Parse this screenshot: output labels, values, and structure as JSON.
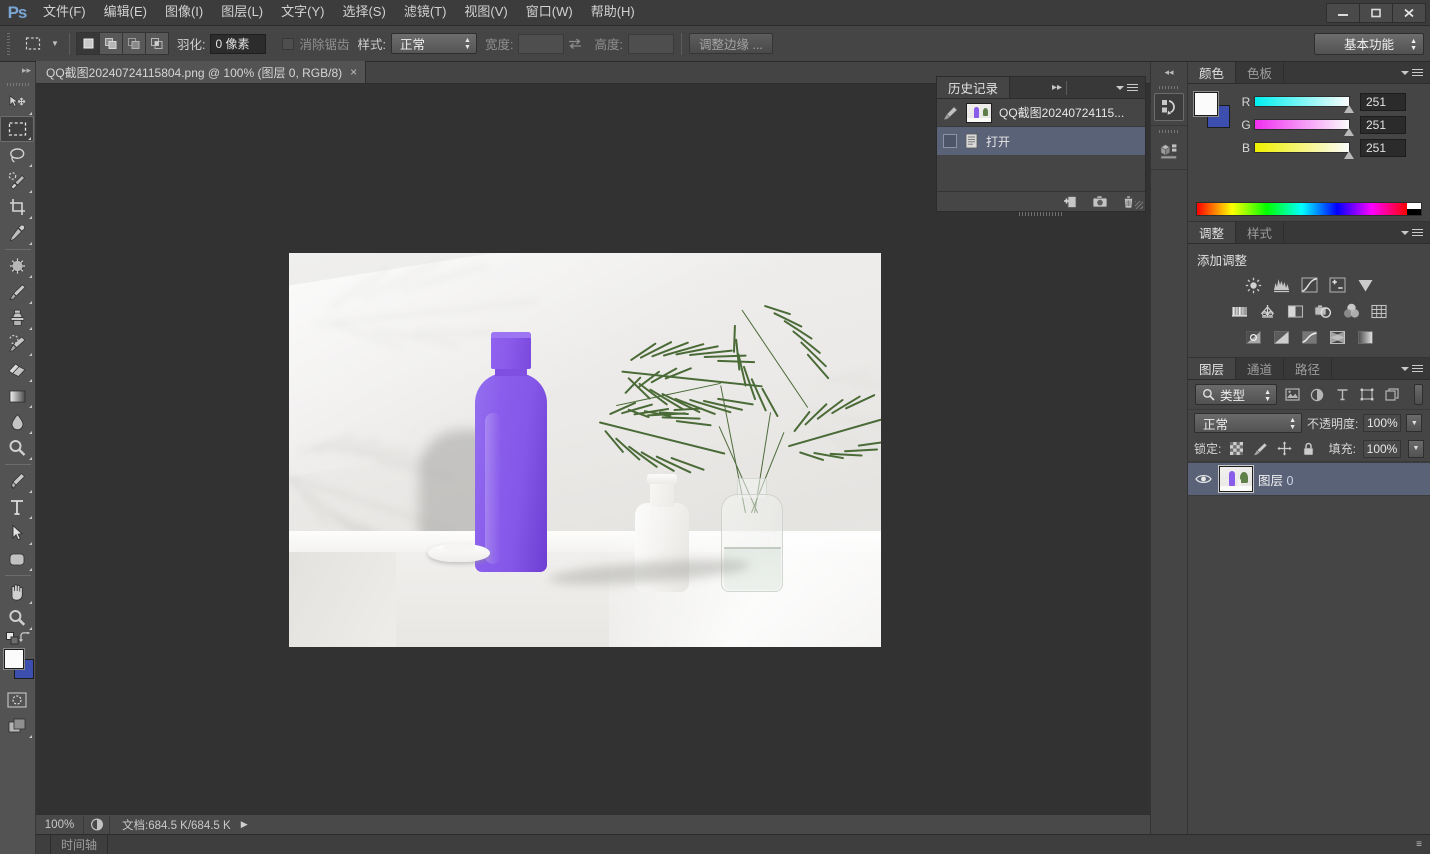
{
  "app": {
    "logo_text": "Ps",
    "accent_color": "#7aa6d6",
    "chrome_bg": "#535353"
  },
  "menubar": {
    "items": [
      {
        "label": "文件(F)",
        "name": "menu-file"
      },
      {
        "label": "编辑(E)",
        "name": "menu-edit"
      },
      {
        "label": "图像(I)",
        "name": "menu-image"
      },
      {
        "label": "图层(L)",
        "name": "menu-layer"
      },
      {
        "label": "文字(Y)",
        "name": "menu-type"
      },
      {
        "label": "选择(S)",
        "name": "menu-select"
      },
      {
        "label": "滤镜(T)",
        "name": "menu-filter"
      },
      {
        "label": "视图(V)",
        "name": "menu-view"
      },
      {
        "label": "窗口(W)",
        "name": "menu-window"
      },
      {
        "label": "帮助(H)",
        "name": "menu-help"
      }
    ]
  },
  "window_controls": {
    "minimize": "minimize-icon",
    "maximize": "maximize-icon",
    "close": "close-icon"
  },
  "options_bar": {
    "tool_icon": "rectangular-marquee-icon",
    "selection_modes": [
      "new-selection",
      "add-to-selection",
      "subtract-from-selection",
      "intersect-with-selection"
    ],
    "active_selection_mode": 0,
    "feather_label": "羽化:",
    "feather_value": "0 像素",
    "antialias_label": "消除锯齿",
    "antialias_checked": false,
    "style_label": "样式:",
    "style_value": "正常",
    "width_label": "宽度:",
    "width_value": "",
    "swap_icon": "swap-dimensions-icon",
    "height_label": "高度:",
    "height_value": "",
    "refine_edge_label": "调整边缘 ...",
    "workspace_value": "基本功能"
  },
  "toolbar": {
    "collapse_icon": "collapse-panel-icon",
    "tools": [
      {
        "name": "move-tool",
        "icon": "move-icon",
        "active": false,
        "has_submenu": true
      },
      {
        "name": "rectangular-marquee-tool",
        "icon": "marquee-icon",
        "active": true,
        "has_submenu": true
      },
      {
        "name": "lasso-tool",
        "icon": "lasso-icon",
        "active": false,
        "has_submenu": true
      },
      {
        "name": "quick-selection-tool",
        "icon": "quick-selection-icon",
        "active": false,
        "has_submenu": true
      },
      {
        "name": "crop-tool",
        "icon": "crop-icon",
        "active": false,
        "has_submenu": true
      },
      {
        "name": "eyedropper-tool",
        "icon": "eyedropper-icon",
        "active": false,
        "has_submenu": true
      },
      {
        "name": "spot-healing-tool",
        "icon": "healing-brush-icon",
        "active": false,
        "has_submenu": true
      },
      {
        "name": "brush-tool",
        "icon": "brush-icon",
        "active": false,
        "has_submenu": true
      },
      {
        "name": "clone-stamp-tool",
        "icon": "clone-stamp-icon",
        "active": false,
        "has_submenu": true
      },
      {
        "name": "history-brush-tool",
        "icon": "history-brush-icon",
        "active": false,
        "has_submenu": true
      },
      {
        "name": "eraser-tool",
        "icon": "eraser-icon",
        "active": false,
        "has_submenu": true
      },
      {
        "name": "gradient-tool",
        "icon": "gradient-icon",
        "active": false,
        "has_submenu": true
      },
      {
        "name": "blur-tool",
        "icon": "blur-drop-icon",
        "active": false,
        "has_submenu": true
      },
      {
        "name": "dodge-tool",
        "icon": "dodge-icon",
        "active": false,
        "has_submenu": true
      },
      {
        "name": "pen-tool",
        "icon": "pen-icon",
        "active": false,
        "has_submenu": true
      },
      {
        "name": "type-tool",
        "icon": "type-t-icon",
        "active": false,
        "has_submenu": true
      },
      {
        "name": "path-selection-tool",
        "icon": "path-arrow-icon",
        "active": false,
        "has_submenu": true
      },
      {
        "name": "shape-tool",
        "icon": "rounded-rect-icon",
        "active": false,
        "has_submenu": true
      },
      {
        "name": "hand-tool",
        "icon": "hand-icon",
        "active": false,
        "has_submenu": true
      },
      {
        "name": "zoom-tool",
        "icon": "magnifier-icon",
        "active": false,
        "has_submenu": true
      }
    ],
    "default_colors_icon": "default-colors-icon",
    "swap_colors_icon": "swap-colors-icon",
    "foreground_color": "#fbfbfb",
    "background_color": "#3c4fae",
    "quick_mask_icon": "quick-mask-icon",
    "screen_mode_icon": "screen-mode-icon"
  },
  "document": {
    "tab_title": "QQ截图20240724115804.png @ 100% (图层 0, RGB/8)",
    "close_icon": "close-tab-icon"
  },
  "status_bar": {
    "zoom": "100%",
    "zoom_icon": "document-profile-icon",
    "doc_label": "文档:684.5 K/684.5 K",
    "expand_icon": "play-arrow-icon"
  },
  "timeline": {
    "tab_label": "时间轴",
    "menu_icon": "panel-menu-icon"
  },
  "mini_dock": {
    "collapse_icon": "expand-panels-icon",
    "buttons": [
      {
        "name": "history-dock-icon",
        "icon": "history-icon",
        "active": true
      },
      {
        "name": "mini-bridge-dock-icon",
        "icon": "mini-bridge-icon",
        "active": false
      }
    ]
  },
  "history_panel": {
    "tabs": [
      {
        "label": "历史记录",
        "active": true
      }
    ],
    "collapse_icon": "collapse-double-arrow-icon",
    "menu_icon": "panel-menu-icon",
    "snapshot": {
      "label": "QQ截图20240724115...",
      "brush_icon": "history-brush-source-icon"
    },
    "states": [
      {
        "label": "打开",
        "icon": "open-document-icon",
        "selected": true
      }
    ],
    "footer_buttons": [
      {
        "name": "new-document-from-state-button",
        "icon": "new-doc-icon"
      },
      {
        "name": "new-snapshot-button",
        "icon": "camera-icon"
      },
      {
        "name": "delete-state-button",
        "icon": "trash-icon"
      }
    ]
  },
  "color_panel": {
    "tabs": [
      {
        "label": "颜色",
        "active": true
      },
      {
        "label": "色板",
        "active": false
      }
    ],
    "menu_icon": "panel-menu-icon",
    "foreground_color": "#fbfbfb",
    "background_color": "#3c4fae",
    "channels": [
      {
        "label": "R",
        "value": "251"
      },
      {
        "label": "G",
        "value": "251"
      },
      {
        "label": "B",
        "value": "251"
      }
    ]
  },
  "adjustments_panel": {
    "tabs": [
      {
        "label": "调整",
        "active": true
      },
      {
        "label": "样式",
        "active": false
      }
    ],
    "menu_icon": "panel-menu-icon",
    "heading": "添加调整",
    "rows": [
      [
        {
          "name": "brightness-contrast-adjustment",
          "icon": "sun-icon"
        },
        {
          "name": "levels-adjustment",
          "icon": "levels-icon"
        },
        {
          "name": "curves-adjustment",
          "icon": "curves-icon"
        },
        {
          "name": "exposure-adjustment",
          "icon": "exposure-icon"
        },
        {
          "name": "vibrance-adjustment",
          "icon": "vibrance-triangle-icon"
        }
      ],
      [
        {
          "name": "hue-saturation-adjustment",
          "icon": "hue-saturation-icon"
        },
        {
          "name": "color-balance-adjustment",
          "icon": "balance-scale-icon"
        },
        {
          "name": "black-white-adjustment",
          "icon": "black-white-icon"
        },
        {
          "name": "photo-filter-adjustment",
          "icon": "camera-filter-icon"
        },
        {
          "name": "channel-mixer-adjustment",
          "icon": "venn-circles-icon"
        },
        {
          "name": "color-lookup-adjustment",
          "icon": "grid-icon"
        }
      ],
      [
        {
          "name": "invert-adjustment",
          "icon": "invert-icon"
        },
        {
          "name": "posterize-adjustment",
          "icon": "posterize-icon"
        },
        {
          "name": "threshold-adjustment",
          "icon": "threshold-icon"
        },
        {
          "name": "gradient-map-adjustment",
          "icon": "gradient-map-icon"
        },
        {
          "name": "selective-color-adjustment",
          "icon": "selective-color-icon"
        }
      ]
    ]
  },
  "layers_panel": {
    "tabs": [
      {
        "label": "图层",
        "active": true
      },
      {
        "label": "通道",
        "active": false
      },
      {
        "label": "路径",
        "active": false
      }
    ],
    "menu_icon": "panel-menu-icon",
    "filter": {
      "search_icon": "search-icon",
      "value": "类型",
      "kind_icons": [
        {
          "name": "filter-pixel-layers-icon",
          "icon": "image-icon"
        },
        {
          "name": "filter-adjustment-layers-icon",
          "icon": "half-circle-icon"
        },
        {
          "name": "filter-type-layers-icon",
          "icon": "type-t-icon"
        },
        {
          "name": "filter-shape-layers-icon",
          "icon": "shape-icon"
        },
        {
          "name": "filter-smart-objects-icon",
          "icon": "smart-object-icon"
        }
      ],
      "toggle_name": "filter-enable-toggle"
    },
    "blend_mode": "正常",
    "opacity_label": "不透明度:",
    "opacity_value": "100%",
    "lock_label": "锁定:",
    "lock_icons": [
      {
        "name": "lock-transparency-icon",
        "icon": "checkerboard-icon"
      },
      {
        "name": "lock-image-pixels-icon",
        "icon": "brush-icon"
      },
      {
        "name": "lock-position-icon",
        "icon": "move-cross-icon"
      },
      {
        "name": "lock-all-icon",
        "icon": "padlock-icon"
      }
    ],
    "fill_label": "填充:",
    "fill_value": "100%",
    "layers": [
      {
        "name": "图层",
        "suffix": "0",
        "visible": true,
        "selected": true,
        "visibility_icon": "eye-icon",
        "thumbnail": "layer-thumbnail"
      }
    ],
    "footer_buttons": [
      {
        "name": "link-layers-button",
        "icon": "link-icon"
      },
      {
        "name": "layer-style-button",
        "icon": "fx-icon"
      },
      {
        "name": "add-layer-mask-button",
        "icon": "mask-icon"
      },
      {
        "name": "new-adjustment-layer-button",
        "icon": "half-circle-icon"
      },
      {
        "name": "new-group-button",
        "icon": "folder-icon"
      },
      {
        "name": "new-layer-button",
        "icon": "new-layer-icon"
      },
      {
        "name": "delete-layer-button",
        "icon": "trash-icon"
      }
    ]
  },
  "canvas": {
    "image_alt": "purple-cosmetic-bottle-photo",
    "background_color": "#323232",
    "zoom_level": "100%"
  }
}
